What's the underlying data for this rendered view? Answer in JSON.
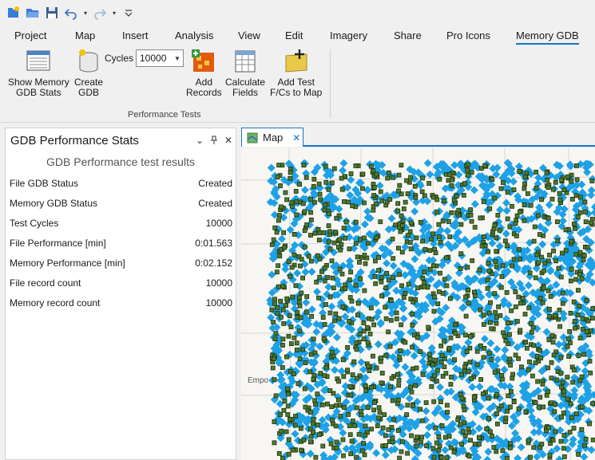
{
  "quick_access": {
    "icons": [
      "new-project-icon",
      "open-project-icon",
      "save-project-icon",
      "undo-icon",
      "redo-icon",
      "customize-qat-icon"
    ]
  },
  "tabs": [
    {
      "label": "Project",
      "active": false
    },
    {
      "label": "Map",
      "active": false
    },
    {
      "label": "Insert",
      "active": false
    },
    {
      "label": "Analysis",
      "active": false
    },
    {
      "label": "View",
      "active": false
    },
    {
      "label": "Edit",
      "active": false
    },
    {
      "label": "Imagery",
      "active": false
    },
    {
      "label": "Share",
      "active": false
    },
    {
      "label": "Pro Icons",
      "active": false
    },
    {
      "label": "Memory GDB",
      "active": true
    }
  ],
  "ribbon": {
    "show_stats": {
      "line1": "Show Memory",
      "line2": "GDB Stats"
    },
    "create_gdb": {
      "line1": "Create",
      "line2": "GDB"
    },
    "cycles_label": "Cycles",
    "cycles_value": "10000",
    "add_records": {
      "line1": "Add",
      "line2": "Records"
    },
    "calculate_fields": {
      "line1": "Calculate",
      "line2": "Fields"
    },
    "add_test": {
      "line1": "Add Test",
      "line2": "F/Cs to Map"
    },
    "group_label": "Performance Tests"
  },
  "pane": {
    "title": "GDB Performance Stats",
    "results_title": "GDB Performance test results",
    "rows": [
      {
        "label": "File GDB Status",
        "value": "Created"
      },
      {
        "label": "Memory GDB Status",
        "value": "Created"
      },
      {
        "label": "Test Cycles",
        "value": "10000"
      },
      {
        "label": "File Performance [min]",
        "value": "0:01.563"
      },
      {
        "label": "Memory Performance [min]",
        "value": "0:02.152"
      },
      {
        "label": "File record count",
        "value": "10000"
      },
      {
        "label": "Memory record count",
        "value": "10000"
      }
    ]
  },
  "map": {
    "tab_label": "Map",
    "place_label": "Empo",
    "colors": {
      "diamond": "#1ea1e6",
      "point_fill": "#4d7a2c",
      "point_stroke": "#1c2e10",
      "basemap": "#f7f6f2",
      "accent": "#1873c4"
    }
  }
}
